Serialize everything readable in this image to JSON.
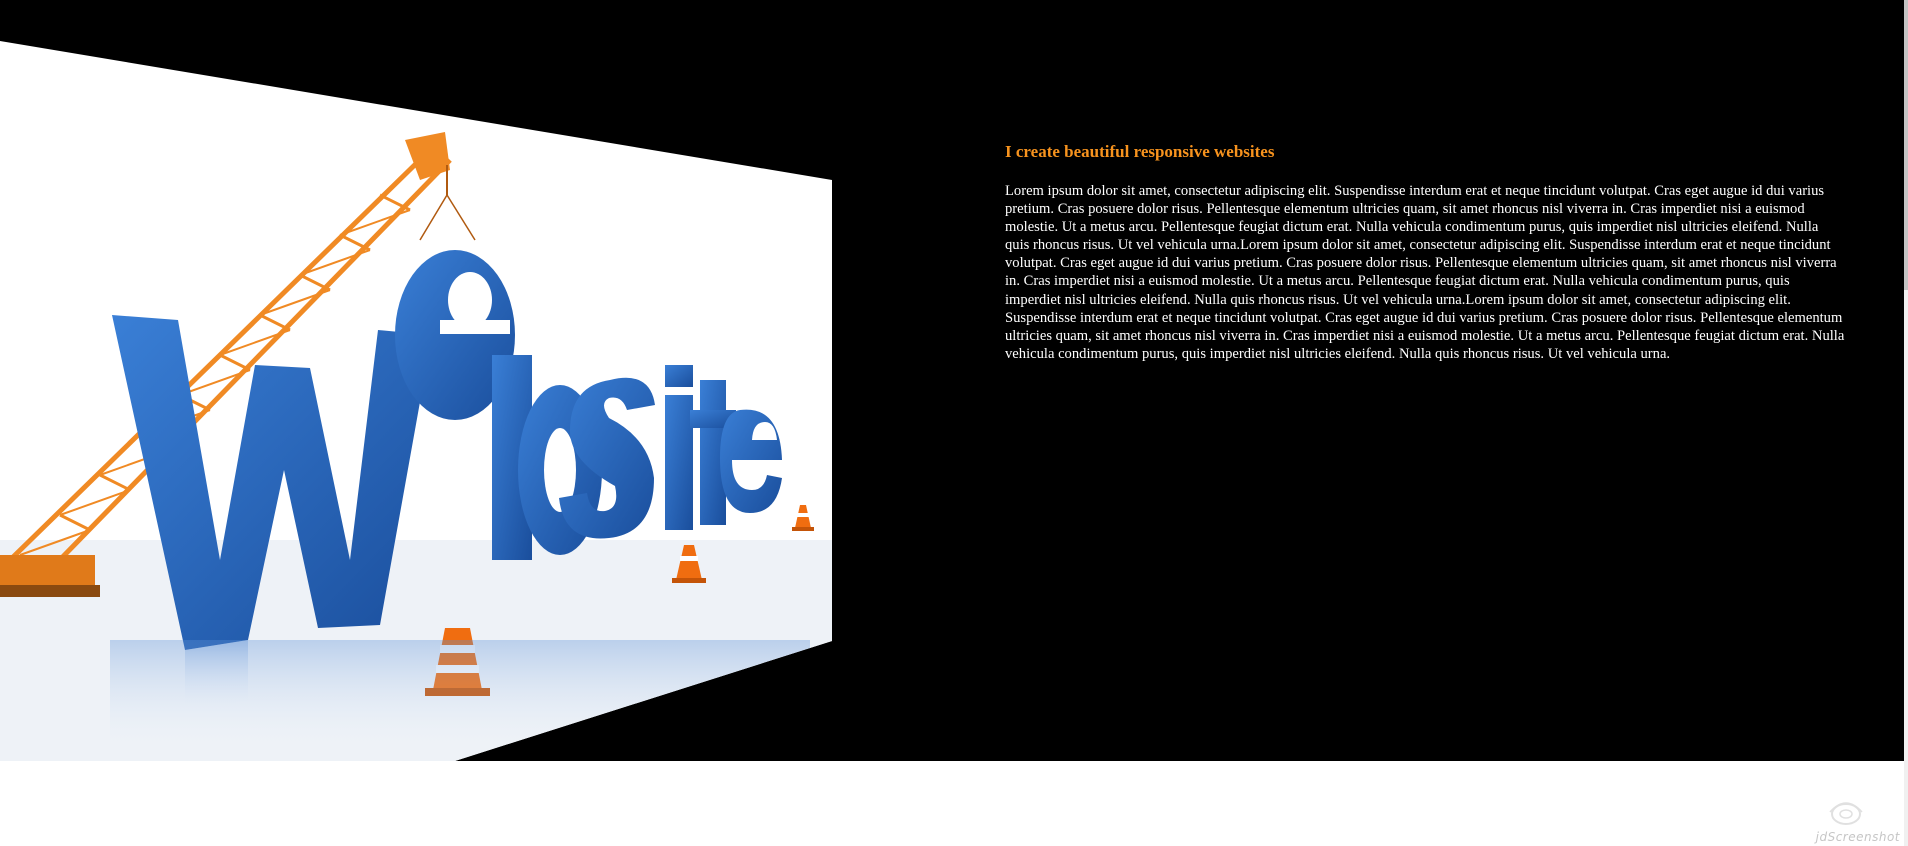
{
  "hero": {
    "image": {
      "word_top": "e",
      "word_main": "W",
      "word_rest": "bsite",
      "word_colour": "#2563b8",
      "crane_colour": "#f08a24",
      "cone_colour": "#f06d10"
    }
  },
  "content": {
    "heading": "I create beautiful responsive websites",
    "body": "Lorem ipsum dolor sit amet, consectetur adipiscing elit. Suspendisse interdum erat et neque tincidunt volutpat. Cras eget augue id dui varius pretium. Cras posuere dolor risus. Pellentesque elementum ultricies quam, sit amet rhoncus nisl viverra in. Cras imperdiet nisi a euismod molestie. Ut a metus arcu. Pellentesque feugiat dictum erat. Nulla vehicula condimentum purus, quis imperdiet nisl ultricies eleifend. Nulla quis rhoncus risus. Ut vel vehicula urna.Lorem ipsum dolor sit amet, consectetur adipiscing elit. Suspendisse interdum erat et neque tincidunt volutpat. Cras eget augue id dui varius pretium. Cras posuere dolor risus. Pellentesque elementum ultricies quam, sit amet rhoncus nisl viverra in. Cras imperdiet nisi a euismod molestie. Ut a metus arcu. Pellentesque feugiat dictum erat. Nulla vehicula condimentum purus, quis imperdiet nisl ultricies eleifend. Nulla quis rhoncus risus. Ut vel vehicula urna.Lorem ipsum dolor sit amet, consectetur adipiscing elit. Suspendisse interdum erat et neque tincidunt volutpat. Cras eget augue id dui varius pretium. Cras posuere dolor risus. Pellentesque elementum ultricies quam, sit amet rhoncus nisl viverra in. Cras imperdiet nisi a euismod molestie. Ut a metus arcu. Pellentesque feugiat dictum erat. Nulla vehicula condimentum purus, quis imperdiet nisl ultricies eleifend. Nulla quis rhoncus risus. Ut vel vehicula urna."
  },
  "theme": {
    "background": "#000000",
    "accent": "#f7931e",
    "text": "#ffffff"
  },
  "watermark": {
    "text": "jdScreenshot",
    "icon": "camera-lens-icon"
  }
}
